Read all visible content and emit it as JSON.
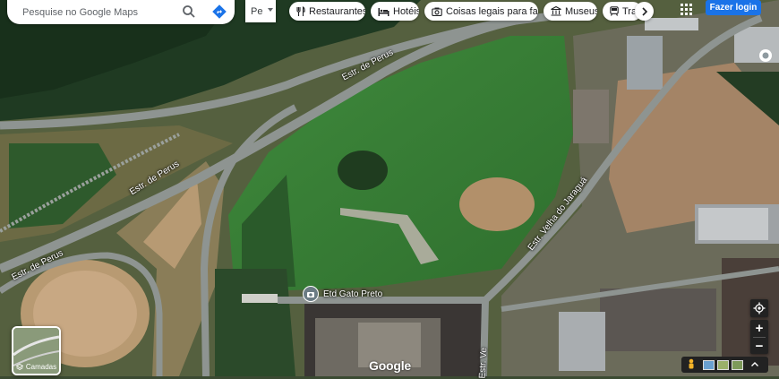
{
  "search": {
    "placeholder": "Pesquise no Google Maps",
    "value": ""
  },
  "travel_mode": {
    "selected": "Pe"
  },
  "categories": [
    {
      "label": "Restaurantes",
      "icon": "fork-knife-icon"
    },
    {
      "label": "Hotéis",
      "icon": "bed-icon"
    },
    {
      "label": "Coisas legais para fa…",
      "icon": "camera-icon"
    },
    {
      "label": "Museus",
      "icon": "museum-icon"
    },
    {
      "label": "Tran",
      "icon": "transit-icon"
    }
  ],
  "header": {
    "login_label": "Fazer login"
  },
  "layers": {
    "label": "Camadas"
  },
  "map": {
    "poi": {
      "name": "Etd Gato Preto"
    },
    "roads": {
      "perus_top": "Estr. de Perus",
      "perus_mid": "Estr. de Perus",
      "perus_left": "Estr. de Perus",
      "jaragua": "Estr. Velha do Jaraguá",
      "vertical": "Estr. Ve"
    }
  },
  "footer": {
    "logo": "Google"
  },
  "controls": {
    "zoom_in": "+",
    "zoom_out": "−"
  },
  "colors": {
    "accent": "#1a73e8",
    "road": "#8e9491"
  }
}
